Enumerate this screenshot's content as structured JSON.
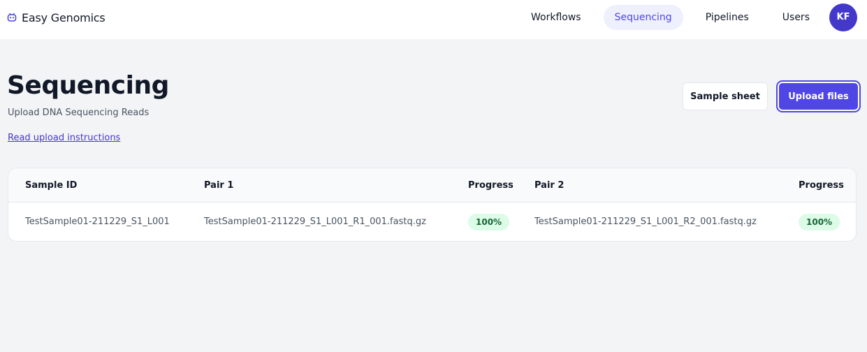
{
  "brand": {
    "name": "Easy Genomics",
    "icon": "robot-face-icon"
  },
  "nav": {
    "items": [
      {
        "label": "Workflows",
        "active": false
      },
      {
        "label": "Sequencing",
        "active": true
      },
      {
        "label": "Pipelines",
        "active": false
      },
      {
        "label": "Users",
        "active": false
      }
    ],
    "avatar_initials": "KF"
  },
  "header": {
    "title": "Sequencing",
    "subtitle": "Upload DNA Sequencing Reads",
    "instructions_link": "Read upload instructions"
  },
  "actions": {
    "sample_sheet_label": "Sample sheet",
    "upload_files_label": "Upload files"
  },
  "table": {
    "columns": [
      "Sample ID",
      "Pair 1",
      "Progress",
      "Pair 2",
      "Progress"
    ],
    "rows": [
      {
        "sample_id": "TestSample01-211229_S1_L001",
        "pair1": "TestSample01-211229_S1_L001_R1_001.fastq.gz",
        "pair1_progress": "100%",
        "pair2": "TestSample01-211229_S1_L001_R2_001.fastq.gz",
        "pair2_progress": "100%"
      }
    ]
  },
  "colors": {
    "accent": "#4f46e5",
    "avatar": "#4338ca",
    "active_nav_bg": "#eef0fe",
    "success_badge_bg": "#dcfce7",
    "success_badge_text": "#166534",
    "page_bg": "#f3f4f6"
  }
}
